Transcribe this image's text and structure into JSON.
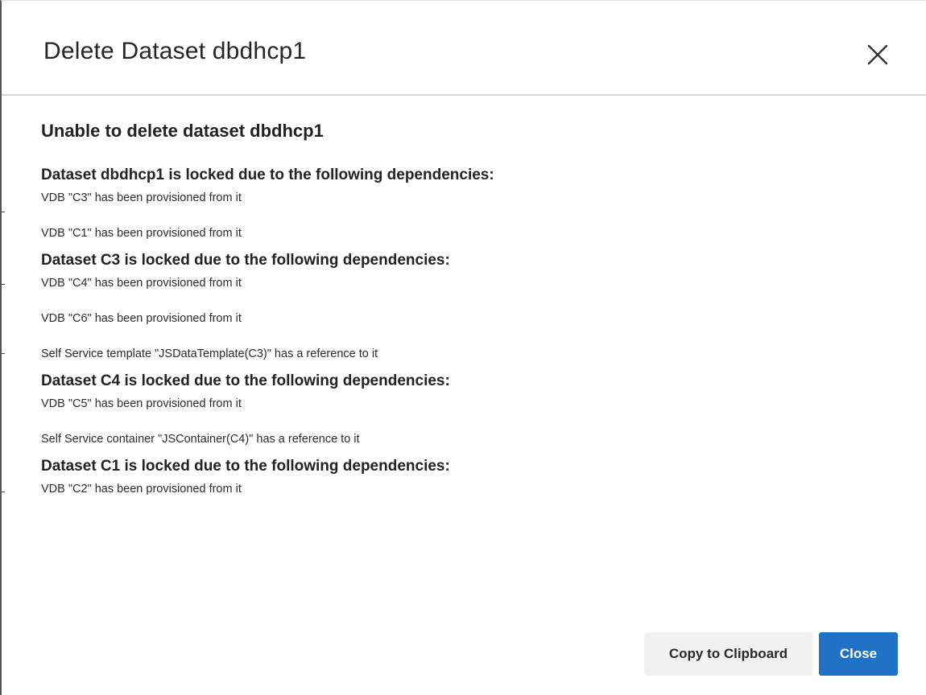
{
  "dialog": {
    "title": "Delete Dataset dbdhcp1",
    "close_icon": "close-icon"
  },
  "content": {
    "heading": "Unable to delete dataset dbdhcp1",
    "groups": [
      {
        "heading": "Dataset dbdhcp1 is locked due to the following dependencies:",
        "items": [
          "VDB \"C3\" has been provisioned from it",
          "VDB \"C1\" has been provisioned from it"
        ]
      },
      {
        "heading": "Dataset C3 is locked due to the following dependencies:",
        "items": [
          "VDB \"C4\" has been provisioned from it",
          "VDB \"C6\" has been provisioned from it",
          "Self Service template \"JSDataTemplate(C3)\" has a reference to it"
        ]
      },
      {
        "heading": "Dataset C4 is locked due to the following dependencies:",
        "items": [
          "VDB \"C5\" has been provisioned from it",
          "Self Service container \"JSContainer(C4)\" has a reference to it"
        ]
      },
      {
        "heading": "Dataset C1 is locked due to the following dependencies:",
        "items": [
          "VDB \"C2\" has been provisioned from it"
        ]
      }
    ]
  },
  "footer": {
    "copy_label": "Copy to Clipboard",
    "close_label": "Close"
  },
  "colors": {
    "primary": "#1f72c5",
    "secondary_button": "#f1f1f1",
    "divider": "#d6d6d6"
  }
}
